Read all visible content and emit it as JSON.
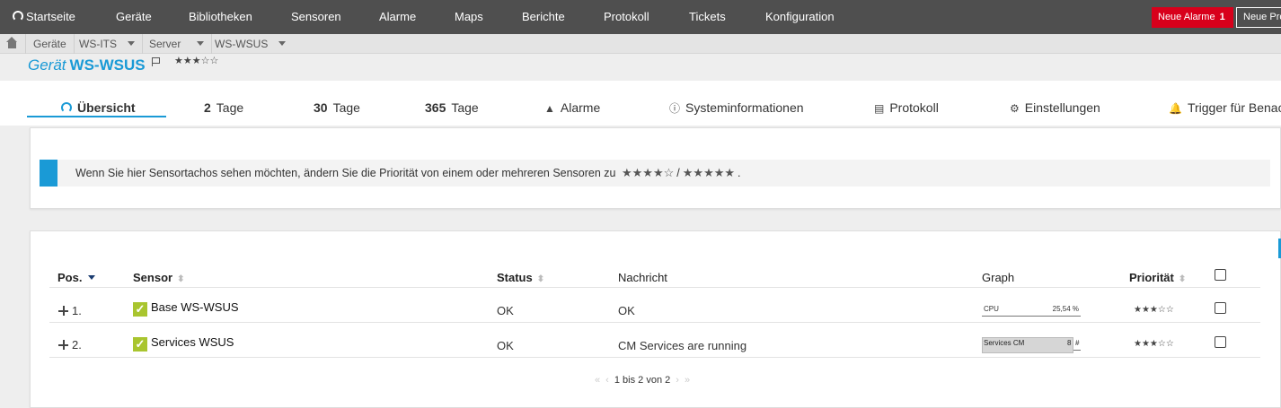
{
  "nav": {
    "home": "Startseite",
    "items": [
      "Geräte",
      "Bibliotheken",
      "Sensoren",
      "Alarme",
      "Maps",
      "Berichte",
      "Protokoll",
      "Tickets",
      "Konfiguration"
    ],
    "alarm_label": "Neue Alarme",
    "alarm_count": "1",
    "new_prio_label": "Neue Pro"
  },
  "breadcrumb": [
    "Geräte",
    "WS-ITS",
    "Server",
    "WS-WSUS"
  ],
  "title": {
    "kind": "Gerät",
    "name": "WS-WSUS",
    "stars": "★★★☆☆"
  },
  "tabs": [
    {
      "label": "Übersicht"
    },
    {
      "num": "2",
      "label": "Tage"
    },
    {
      "num": "30",
      "label": "Tage"
    },
    {
      "num": "365",
      "label": "Tage"
    },
    {
      "label": "Alarme"
    },
    {
      "label": "Systeminformationen"
    },
    {
      "label": "Protokoll"
    },
    {
      "label": "Einstellungen"
    },
    {
      "label": "Trigger für Benac"
    }
  ],
  "info": {
    "text": "Wenn Sie hier Sensortachos sehen möchten, ändern Sie die Priorität von einem oder mehreren Sensoren zu",
    "stars4": "★★★★☆",
    "sep": "/",
    "stars5": "★★★★★",
    "end": "."
  },
  "table": {
    "headers": {
      "pos": "Pos.",
      "sensor": "Sensor",
      "status": "Status",
      "message": "Nachricht",
      "graph": "Graph",
      "priority": "Priorität"
    },
    "rows": [
      {
        "pos": "1.",
        "sensor": "Base WS-WSUS",
        "status": "OK",
        "message": "OK",
        "graph_label": "CPU",
        "graph_value": "25,54 %",
        "graph_fraction": 0.2554,
        "stars": "★★★☆☆"
      },
      {
        "pos": "2.",
        "sensor": "Services WSUS",
        "status": "OK",
        "message": "CM Services are running",
        "graph_label": "Services CM",
        "graph_value": "8",
        "graph_unit": "#",
        "stars": "★★★☆☆"
      }
    ],
    "pager": "1 bis 2 von 2"
  },
  "colors": {
    "accent": "#1a9ad6",
    "alarm": "#d8001b",
    "ok": "#a9c52f",
    "navbar": "#4f4f4f"
  }
}
